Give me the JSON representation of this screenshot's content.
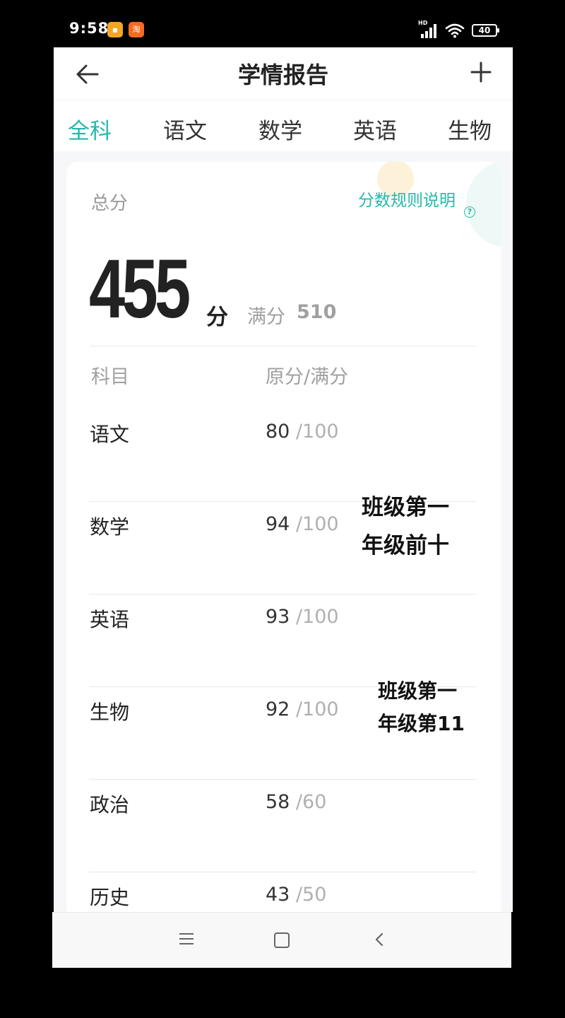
{
  "status_bar": {
    "time": "9:58",
    "notification_icons": [
      "note-icon",
      "taobao-icon"
    ],
    "taobao_glyph": "淘",
    "network_label": "HD",
    "battery": "40"
  },
  "header": {
    "title": "学情报告",
    "back_icon": "arrow-left-icon",
    "add_icon": "plus-icon"
  },
  "tabs": [
    {
      "label": "全科",
      "active": true
    },
    {
      "label": "语文",
      "active": false
    },
    {
      "label": "数学",
      "active": false
    },
    {
      "label": "英语",
      "active": false
    },
    {
      "label": "生物",
      "active": false
    }
  ],
  "summary": {
    "total_label": "总分",
    "rules_link": "分数规则说明",
    "total_score": "455",
    "score_unit": "分",
    "full_label": "满分",
    "full_score": "510"
  },
  "table": {
    "headers": {
      "subject": "科目",
      "score": "原分/满分"
    },
    "rows": [
      {
        "subject": "语文",
        "raw": "80",
        "full": "/100"
      },
      {
        "subject": "数学",
        "raw": "94",
        "full": "/100"
      },
      {
        "subject": "英语",
        "raw": "93",
        "full": "/100"
      },
      {
        "subject": "生物",
        "raw": "92",
        "full": "/100"
      },
      {
        "subject": "政治",
        "raw": "58",
        "full": "/60"
      },
      {
        "subject": "历史",
        "raw": "43",
        "full": "/50"
      }
    ]
  },
  "annotations": {
    "math_line1": "班级第一",
    "math_line2": "年级前十",
    "bio_line1": "班级第一",
    "bio_line2": "年级第11"
  },
  "colors": {
    "accent": "#25b8a9",
    "text_primary": "#222222",
    "text_muted": "#a0a0a0"
  },
  "navbar": {
    "icons": [
      "menu-icon",
      "home-icon",
      "back-icon"
    ]
  }
}
